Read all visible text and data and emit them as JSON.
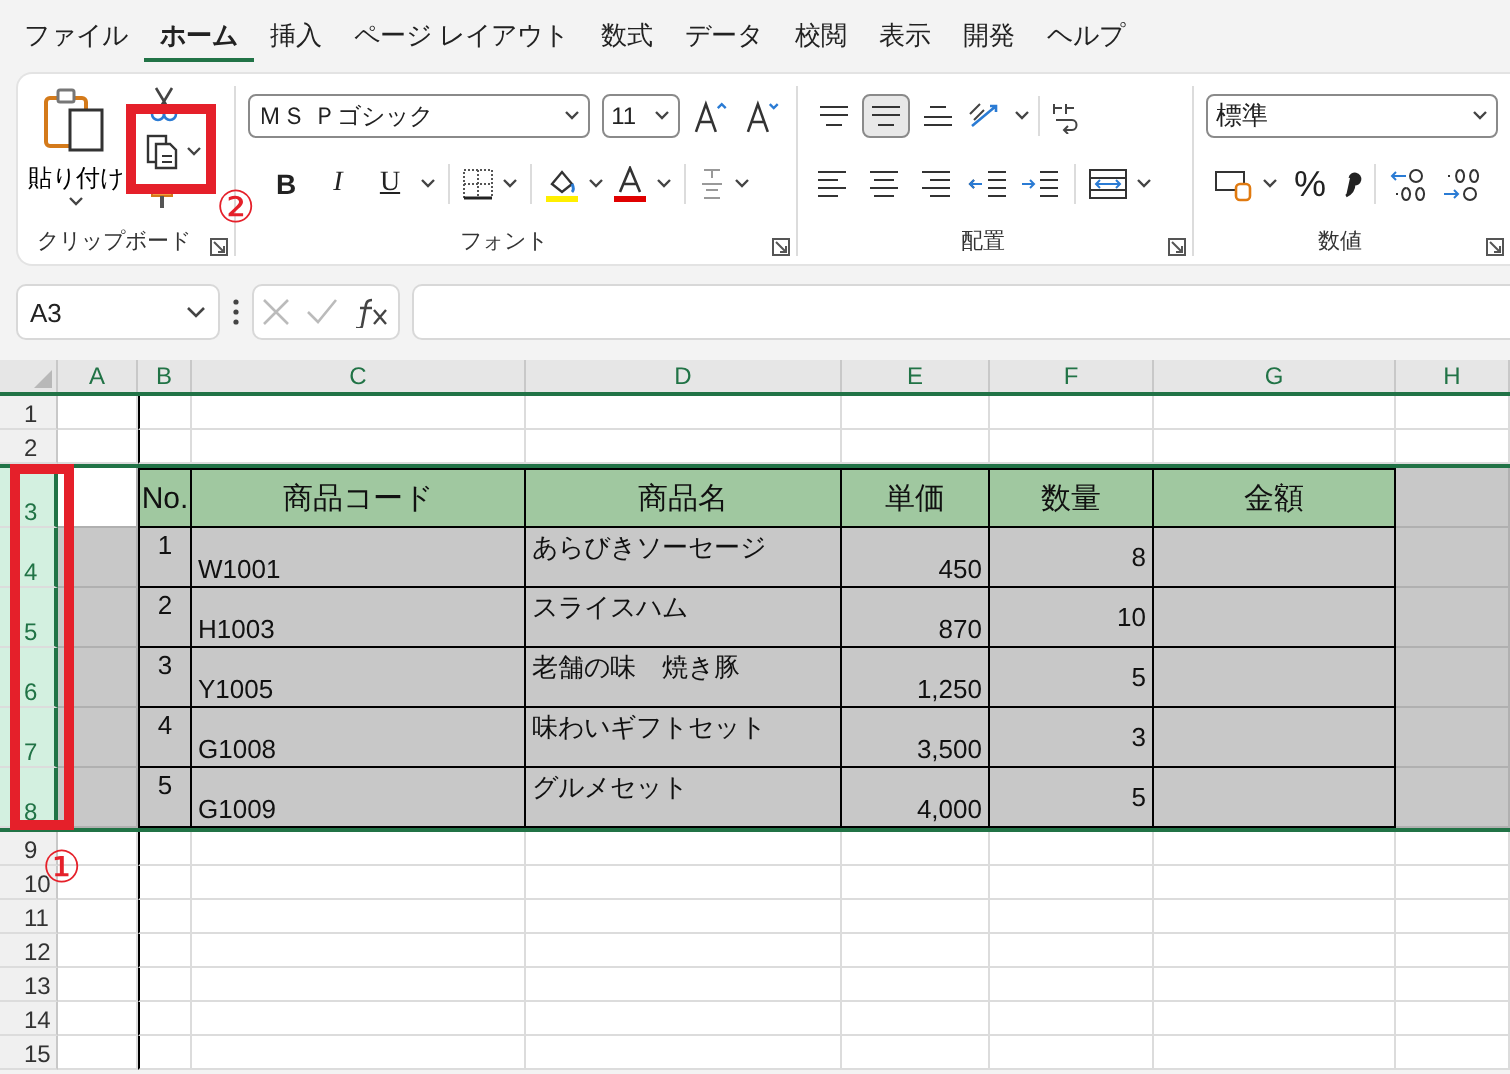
{
  "menu_tabs": [
    {
      "label": "ファイル",
      "selected": false
    },
    {
      "label": "ホーム",
      "selected": true
    },
    {
      "label": "挿入",
      "selected": false
    },
    {
      "label": "ページ レイアウト",
      "selected": false
    },
    {
      "label": "数式",
      "selected": false
    },
    {
      "label": "データ",
      "selected": false
    },
    {
      "label": "校閲",
      "selected": false
    },
    {
      "label": "表示",
      "selected": false
    },
    {
      "label": "開発",
      "selected": false
    },
    {
      "label": "ヘルプ",
      "selected": false
    }
  ],
  "ribbon": {
    "clipboard": {
      "paste_label": "貼り付け",
      "group_label": "クリップボード"
    },
    "font": {
      "font_name": "ＭＳ Ｐゴシック",
      "font_size": "11",
      "style_buttons": [
        "B",
        "I",
        "U"
      ],
      "group_label": "フォント"
    },
    "alignment": {
      "vertical_align": [
        {
          "kind": "top",
          "selected": false
        },
        {
          "kind": "middle",
          "selected": true
        },
        {
          "kind": "bottom",
          "selected": false
        }
      ],
      "group_label": "配置"
    },
    "number": {
      "format": "標準",
      "percent": "%",
      "group_label": "数値"
    }
  },
  "formula_bar": {
    "name_box": "A3"
  },
  "sheet": {
    "columns": [
      {
        "label": "A",
        "selected": true
      },
      {
        "label": "B",
        "selected": true
      },
      {
        "label": "C",
        "selected": true
      },
      {
        "label": "D",
        "selected": true
      },
      {
        "label": "E",
        "selected": true
      },
      {
        "label": "F",
        "selected": true
      },
      {
        "label": "G",
        "selected": true
      },
      {
        "label": "H",
        "selected": true
      }
    ],
    "rows": [
      {
        "header": "1",
        "kind": "blank",
        "selected": false,
        "cells": {}
      },
      {
        "header": "2",
        "kind": "blank",
        "selected": false,
        "cells": {}
      },
      {
        "header": "3",
        "kind": "header",
        "selected": true,
        "cells": {
          "B": "No.",
          "C": "商品コード",
          "D": "商品名",
          "E": "単価",
          "F": "数量",
          "G": "金額"
        }
      },
      {
        "header": "4",
        "kind": "data",
        "selected": true,
        "cells": {
          "B": "1",
          "C": "W1001",
          "D": "あらびきソーセージ",
          "E": "450",
          "F": "8"
        }
      },
      {
        "header": "5",
        "kind": "data",
        "selected": true,
        "cells": {
          "B": "2",
          "C": "H1003",
          "D": "スライスハム",
          "E": "870",
          "F": "10"
        }
      },
      {
        "header": "6",
        "kind": "data",
        "selected": true,
        "cells": {
          "B": "3",
          "C": "Y1005",
          "D": "老舗の味　焼き豚",
          "E": "1,250",
          "F": "5"
        }
      },
      {
        "header": "7",
        "kind": "data",
        "selected": true,
        "cells": {
          "B": "4",
          "C": "G1008",
          "D": "味わいギフトセット",
          "E": "3,500",
          "F": "3"
        }
      },
      {
        "header": "8",
        "kind": "data",
        "selected": true,
        "cells": {
          "B": "5",
          "C": "G1009",
          "D": "グルメセット",
          "E": "4,000",
          "F": "5"
        }
      },
      {
        "header": "9",
        "kind": "blank",
        "selected": false,
        "cells": {}
      },
      {
        "header": "10",
        "kind": "blank",
        "selected": false,
        "cells": {}
      },
      {
        "header": "11",
        "kind": "blank",
        "selected": false,
        "cells": {}
      },
      {
        "header": "12",
        "kind": "blank",
        "selected": false,
        "cells": {}
      },
      {
        "header": "13",
        "kind": "blank",
        "selected": false,
        "cells": {}
      },
      {
        "header": "14",
        "kind": "blank",
        "selected": false,
        "cells": {}
      },
      {
        "header": "15",
        "kind": "blank",
        "selected": false,
        "cells": {}
      }
    ]
  },
  "annotations": [
    {
      "label": "①",
      "kind": "row_frame"
    },
    {
      "label": "②",
      "kind": "button_frame"
    }
  ]
}
